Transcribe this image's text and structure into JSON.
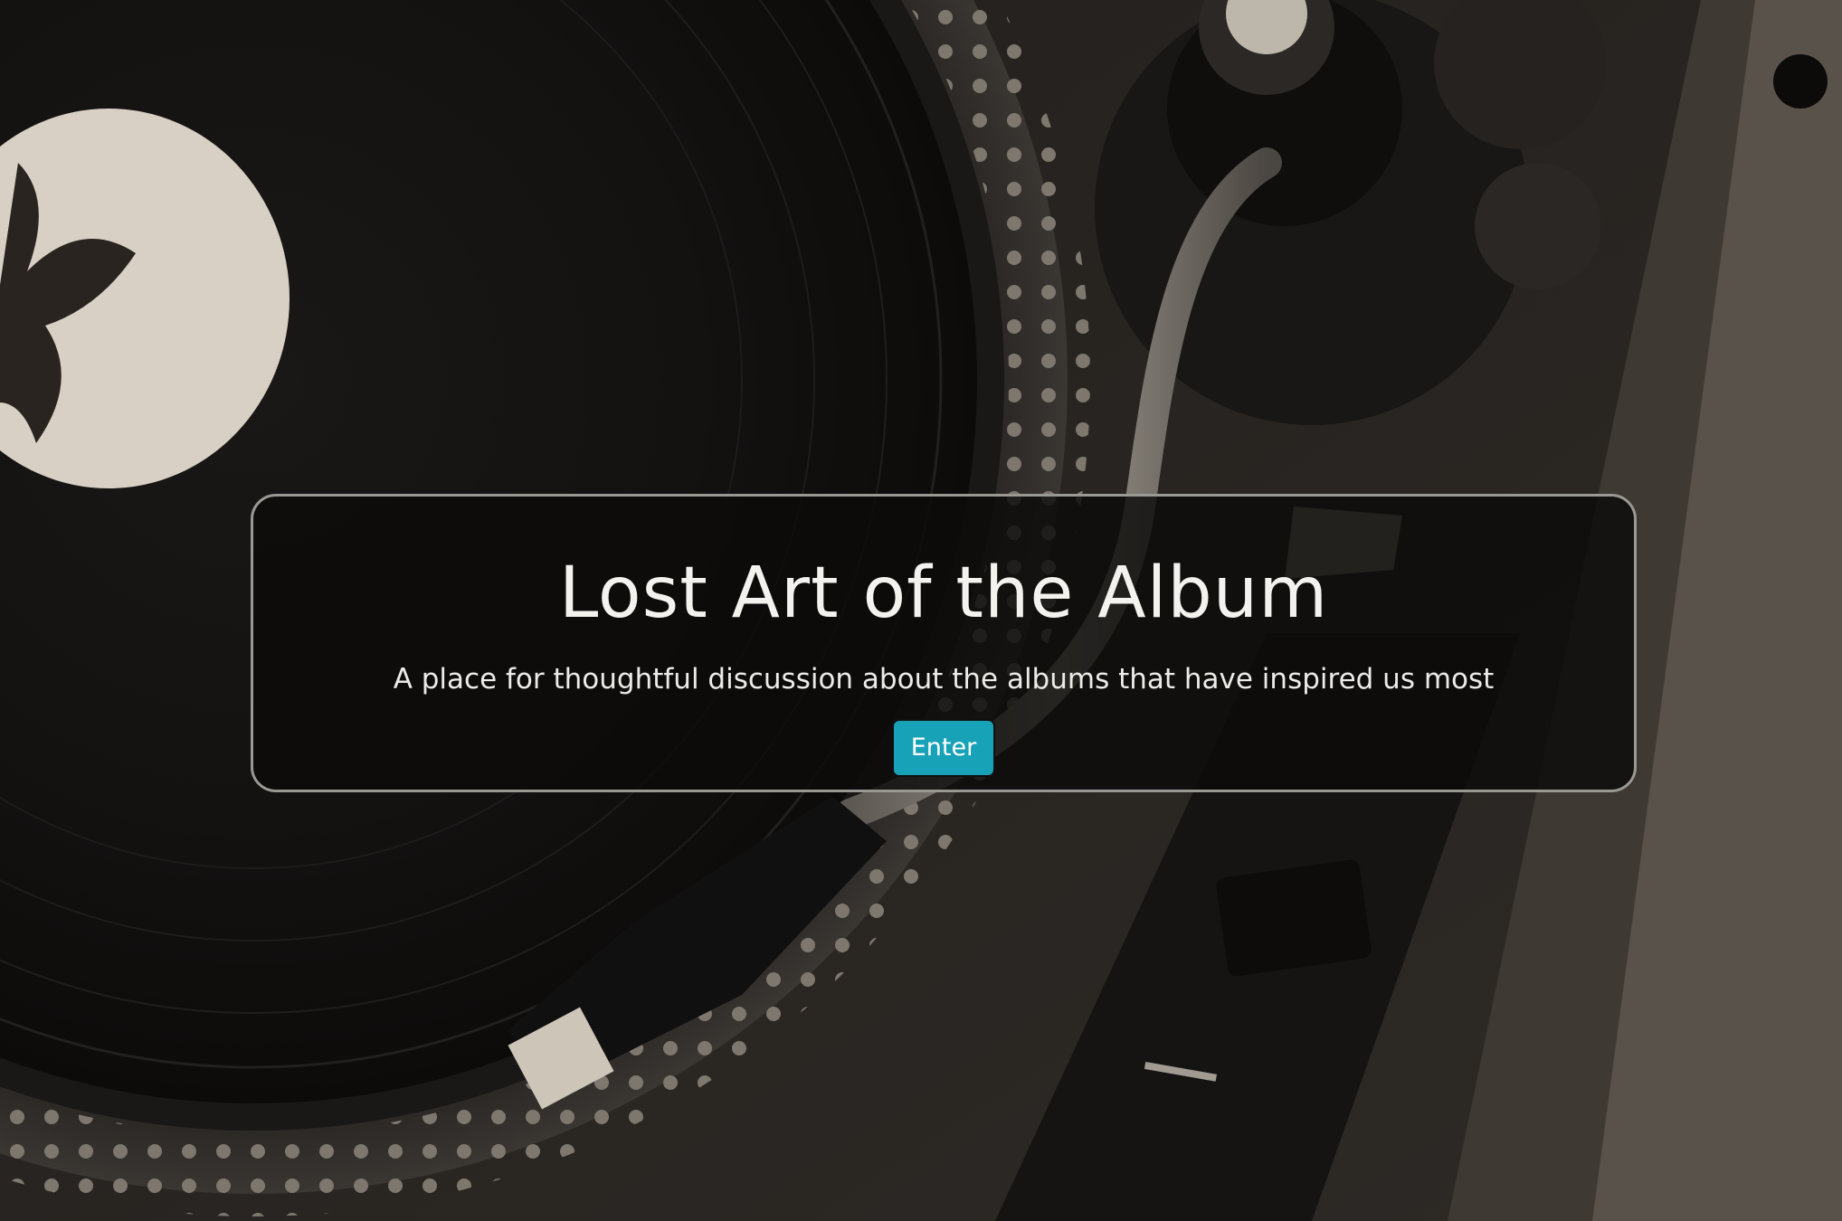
{
  "hero": {
    "title": "Lost Art of the Album",
    "subtitle": "A place for thoughtful discussion about the albums that have inspired us most",
    "enter_label": "Enter"
  },
  "background": {
    "subject": "turntable-photo",
    "tone": "sepia"
  },
  "colors": {
    "button": "#17a2b8",
    "panel_border": "#9a9893",
    "text": "#f4f2ee"
  }
}
